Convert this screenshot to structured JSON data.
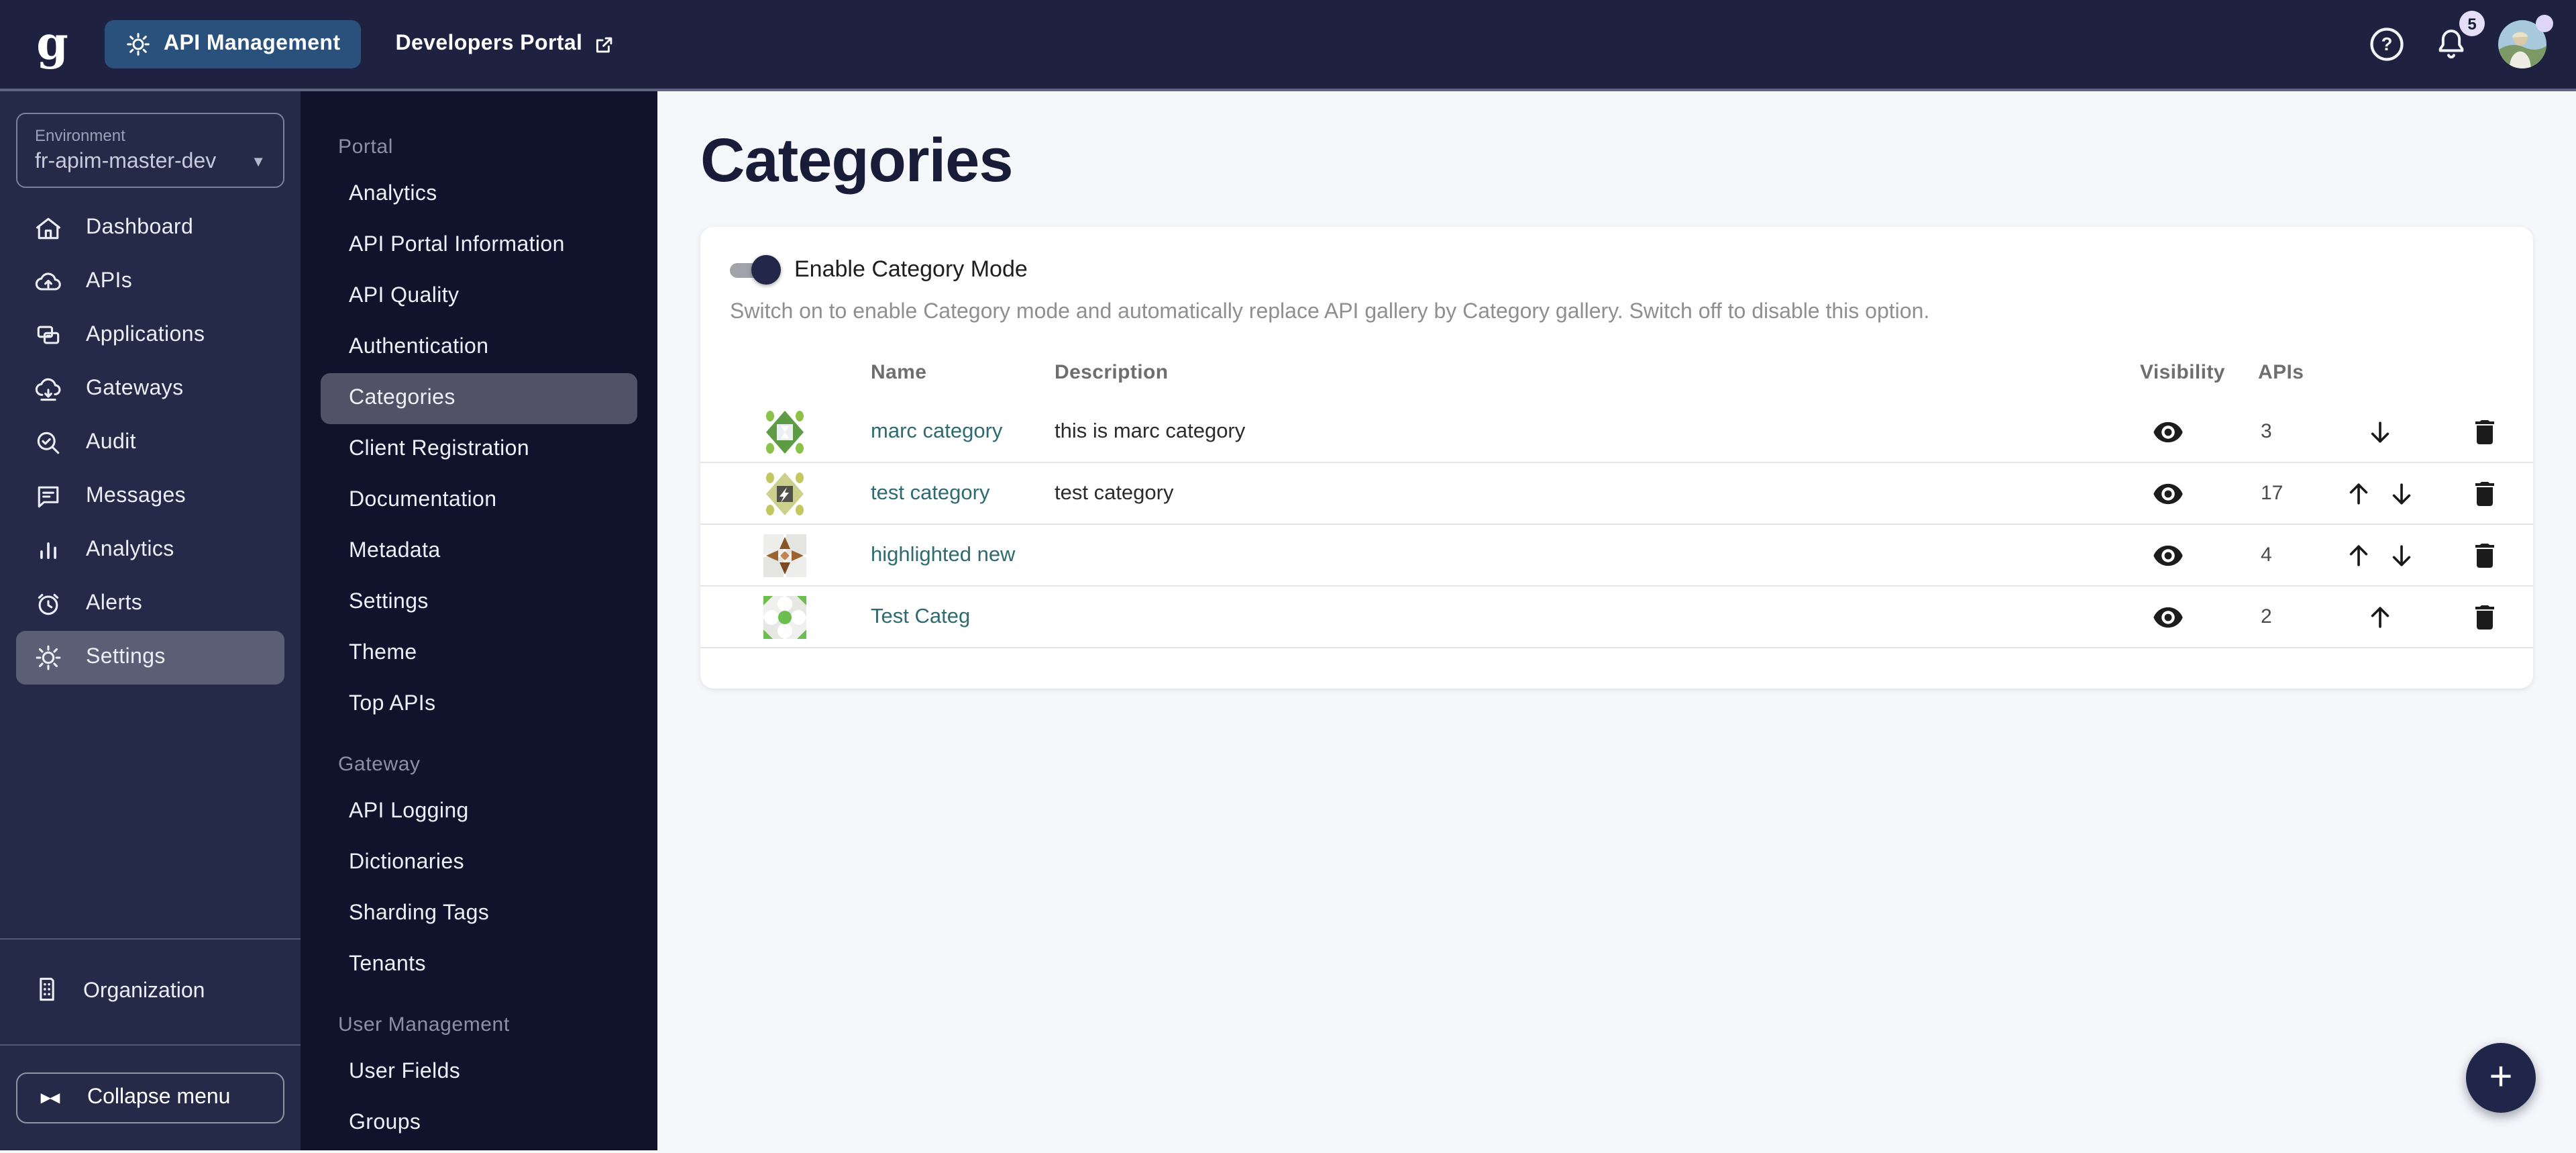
{
  "header": {
    "logo": "g",
    "app_badge": "API Management",
    "portal_link": "Developers Portal",
    "notifications_count": "5"
  },
  "colors": {
    "topbar_bg": "#1e2240",
    "sidebar_bg": "#252a49",
    "subsidebar_bg": "#11132c",
    "main_bg": "#f6f7fb",
    "badge_blue": "#2a517c",
    "link_teal": "#2e6b70",
    "notif_lavender": "#e4def8"
  },
  "sidebar": {
    "environment": {
      "label": "Environment",
      "value": "fr-apim-master-dev"
    },
    "items": [
      {
        "label": "Dashboard",
        "icon": "home-icon",
        "selected": false
      },
      {
        "label": "APIs",
        "icon": "cloud-upload-icon",
        "selected": false
      },
      {
        "label": "Applications",
        "icon": "applications-icon",
        "selected": false
      },
      {
        "label": "Gateways",
        "icon": "cloud-download-icon",
        "selected": false
      },
      {
        "label": "Audit",
        "icon": "search-check-icon",
        "selected": false
      },
      {
        "label": "Messages",
        "icon": "message-icon",
        "selected": false
      },
      {
        "label": "Analytics",
        "icon": "bar-chart-icon",
        "selected": false
      },
      {
        "label": "Alerts",
        "icon": "alarm-icon",
        "selected": false
      },
      {
        "label": "Settings",
        "icon": "gear-icon",
        "selected": true
      }
    ],
    "organization": {
      "label": "Organization"
    },
    "collapse": {
      "label": "Collapse menu"
    }
  },
  "subsidebar": {
    "sections": [
      {
        "title": "Portal",
        "items": [
          "Analytics",
          "API Portal Information",
          "API Quality",
          "Authentication",
          "Categories",
          "Client Registration",
          "Documentation",
          "Metadata",
          "Settings",
          "Theme",
          "Top APIs"
        ],
        "selected_item": "Categories"
      },
      {
        "title": "Gateway",
        "items": [
          "API Logging",
          "Dictionaries",
          "Sharding Tags",
          "Tenants"
        ]
      },
      {
        "title": "User Management",
        "items": [
          "User Fields",
          "Groups"
        ]
      }
    ]
  },
  "main": {
    "title": "Categories",
    "category_mode": {
      "toggle_label": "Enable Category Mode",
      "enabled": true,
      "description": "Switch on to enable Category mode and automatically replace API gallery by Category gallery. Switch off to disable this option."
    },
    "table": {
      "columns": {
        "name": "Name",
        "description": "Description",
        "visibility": "Visibility",
        "apis": "APIs"
      },
      "rows": [
        {
          "icon": "green-diamond",
          "name": "marc category",
          "description": "this is marc category",
          "visibility": "visible",
          "apis": "3",
          "move_up": false,
          "move_down": true
        },
        {
          "icon": "olive-bolt",
          "name": "test category",
          "description": "test category",
          "visibility": "visible",
          "apis": "17",
          "move_up": true,
          "move_down": true
        },
        {
          "icon": "brown-pinwheel",
          "name": "highlighted new",
          "description": "",
          "visibility": "visible",
          "apis": "4",
          "move_up": true,
          "move_down": true
        },
        {
          "icon": "green-flower",
          "name": "Test Categ",
          "description": "",
          "visibility": "visible",
          "apis": "2",
          "move_up": true,
          "move_down": false
        }
      ]
    },
    "fab_label": "+"
  }
}
